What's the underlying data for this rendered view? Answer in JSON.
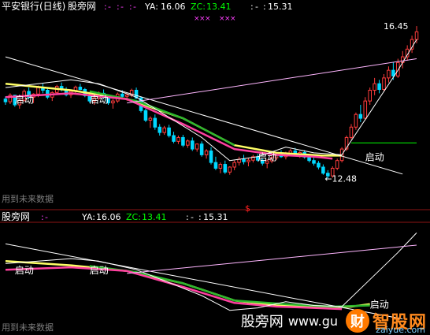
{
  "chart_data": [
    {
      "type": "candlestick",
      "panel": "main",
      "header": {
        "title": "平安银行(日线)",
        "indicator": "股旁网",
        "fields": [
          {
            "label": ":",
            "value": "-",
            "color": "#ff40ff"
          },
          {
            "label": ":",
            "value": "-",
            "color": "#ff40ff"
          },
          {
            "label": ":",
            "value": "-",
            "color": "#ff40ff"
          },
          {
            "label": "YA:",
            "value": "16.06",
            "color": "#ffffff"
          },
          {
            "label": "ZC:",
            "value": "13.41",
            "color": "#00ff00"
          },
          {
            "label": ":",
            "value": "-",
            "color": "#ffffff"
          },
          {
            "label": ":",
            "value": "15.31",
            "color": "#ffffff"
          }
        ]
      },
      "ohlc": [
        [
          14.55,
          14.62,
          14.4,
          14.48
        ],
        [
          14.48,
          14.7,
          14.42,
          14.65
        ],
        [
          14.65,
          14.66,
          14.35,
          14.4
        ],
        [
          14.4,
          14.55,
          14.3,
          14.52
        ],
        [
          14.52,
          14.8,
          14.48,
          14.75
        ],
        [
          14.75,
          14.85,
          14.55,
          14.6
        ],
        [
          14.6,
          14.7,
          14.45,
          14.68
        ],
        [
          14.68,
          14.9,
          14.6,
          14.85
        ],
        [
          14.85,
          14.95,
          14.7,
          14.78
        ],
        [
          14.78,
          14.82,
          14.55,
          14.6
        ],
        [
          14.6,
          14.75,
          14.5,
          14.72
        ],
        [
          14.72,
          14.92,
          14.66,
          14.88
        ],
        [
          14.88,
          14.98,
          14.75,
          14.8
        ],
        [
          14.8,
          14.86,
          14.62,
          14.66
        ],
        [
          14.66,
          14.8,
          14.58,
          14.75
        ],
        [
          14.75,
          14.9,
          14.7,
          14.86
        ],
        [
          14.86,
          14.95,
          14.78,
          14.8
        ],
        [
          14.8,
          14.84,
          14.6,
          14.64
        ],
        [
          14.64,
          14.7,
          14.45,
          14.5
        ],
        [
          14.5,
          14.62,
          14.4,
          14.58
        ],
        [
          14.58,
          14.75,
          14.52,
          14.7
        ],
        [
          14.7,
          14.8,
          14.55,
          14.6
        ],
        [
          14.6,
          14.66,
          14.4,
          14.45
        ],
        [
          14.45,
          14.55,
          14.3,
          14.5
        ],
        [
          14.5,
          14.72,
          14.45,
          14.68
        ],
        [
          14.68,
          14.78,
          14.58,
          14.62
        ],
        [
          14.62,
          14.7,
          14.5,
          14.66
        ],
        [
          14.66,
          14.82,
          14.6,
          14.78
        ],
        [
          14.78,
          14.85,
          14.55,
          14.58
        ],
        [
          14.58,
          14.62,
          14.2,
          14.25
        ],
        [
          14.25,
          14.3,
          13.95,
          14.0
        ],
        [
          14.0,
          14.1,
          13.8,
          14.05
        ],
        [
          14.05,
          14.15,
          13.75,
          13.82
        ],
        [
          13.82,
          13.9,
          13.6,
          13.68
        ],
        [
          13.68,
          13.85,
          13.62,
          13.8
        ],
        [
          13.8,
          13.88,
          13.55,
          13.6
        ],
        [
          13.6,
          13.7,
          13.4,
          13.45
        ],
        [
          13.45,
          13.6,
          13.38,
          13.55
        ],
        [
          13.55,
          13.62,
          13.3,
          13.35
        ],
        [
          13.35,
          13.5,
          13.28,
          13.46
        ],
        [
          13.46,
          13.55,
          13.2,
          13.25
        ],
        [
          13.25,
          13.4,
          13.18,
          13.38
        ],
        [
          13.38,
          13.45,
          13.05,
          13.1
        ],
        [
          13.1,
          13.25,
          13.0,
          13.2
        ],
        [
          13.2,
          13.3,
          12.85,
          12.9
        ],
        [
          12.9,
          13.05,
          12.7,
          12.75
        ],
        [
          12.75,
          12.9,
          12.62,
          12.85
        ],
        [
          12.85,
          12.95,
          12.6,
          12.65
        ],
        [
          12.65,
          12.8,
          12.58,
          12.78
        ],
        [
          12.78,
          12.95,
          12.7,
          12.9
        ],
        [
          12.9,
          13.05,
          12.82,
          12.98
        ],
        [
          12.98,
          13.1,
          12.85,
          12.92
        ],
        [
          12.92,
          13.02,
          12.8,
          12.96
        ],
        [
          12.96,
          13.1,
          12.9,
          13.05
        ],
        [
          13.05,
          13.12,
          12.92,
          12.96
        ],
        [
          12.96,
          13.0,
          12.82,
          12.88
        ],
        [
          12.88,
          12.98,
          12.75,
          12.94
        ],
        [
          12.94,
          13.08,
          12.88,
          13.02
        ],
        [
          13.02,
          13.15,
          12.96,
          13.1
        ],
        [
          13.1,
          13.22,
          13.02,
          13.05
        ],
        [
          13.05,
          13.18,
          12.98,
          13.14
        ],
        [
          13.14,
          13.25,
          13.08,
          13.2
        ],
        [
          13.2,
          13.28,
          13.08,
          13.12
        ],
        [
          13.12,
          13.2,
          13.02,
          13.16
        ],
        [
          13.16,
          13.22,
          13.0,
          13.04
        ],
        [
          13.04,
          13.1,
          12.9,
          12.95
        ],
        [
          12.95,
          13.02,
          12.82,
          12.88
        ],
        [
          12.88,
          12.94,
          12.72,
          12.78
        ],
        [
          12.78,
          12.85,
          12.58,
          12.62
        ],
        [
          12.62,
          12.7,
          12.48,
          12.55
        ],
        [
          12.55,
          12.8,
          12.5,
          12.75
        ],
        [
          12.75,
          13.0,
          12.7,
          12.95
        ],
        [
          12.95,
          13.3,
          12.9,
          13.25
        ],
        [
          13.25,
          13.6,
          13.2,
          13.55
        ],
        [
          13.55,
          13.9,
          13.5,
          13.82
        ],
        [
          13.82,
          14.2,
          13.75,
          14.15
        ],
        [
          14.15,
          14.4,
          13.95,
          14.05
        ],
        [
          14.05,
          14.6,
          14.0,
          14.5
        ],
        [
          14.5,
          14.85,
          14.4,
          14.78
        ],
        [
          14.78,
          15.1,
          14.65,
          14.95
        ],
        [
          14.95,
          15.05,
          14.7,
          14.8
        ],
        [
          14.8,
          15.2,
          14.75,
          15.1
        ],
        [
          15.1,
          15.4,
          14.98,
          15.3
        ],
        [
          15.3,
          15.5,
          15.05,
          15.15
        ],
        [
          15.15,
          15.6,
          15.1,
          15.5
        ],
        [
          15.5,
          15.8,
          15.35,
          15.65
        ],
        [
          15.65,
          15.95,
          15.55,
          15.85
        ],
        [
          15.85,
          16.2,
          15.75,
          16.1
        ],
        [
          16.1,
          16.45,
          16.0,
          16.3
        ]
      ],
      "lines": [
        {
          "color": "#ffff66",
          "width": 2.5,
          "points": [
            [
              0,
              14.95
            ],
            [
              14,
              14.78
            ],
            [
              26,
              14.55
            ],
            [
              38,
              14.05
            ],
            [
              49,
              13.35
            ],
            [
              58,
              13.15
            ],
            [
              68,
              13.08
            ],
            [
              72,
              13.08
            ]
          ]
        },
        {
          "color": "#2db82d",
          "width": 2.5,
          "points": [
            [
              18,
              14.75
            ],
            [
              28,
              14.5
            ],
            [
              38,
              14.05
            ],
            [
              49,
              13.35
            ]
          ]
        },
        {
          "color": "#ff40a0",
          "width": 2.5,
          "points": [
            [
              0,
              14.6
            ],
            [
              14,
              14.7
            ],
            [
              26,
              14.55
            ],
            [
              38,
              13.9
            ],
            [
              49,
              13.25
            ],
            [
              58,
              13.1
            ],
            [
              66,
              13.05
            ],
            [
              70,
              13.0
            ]
          ]
        },
        {
          "color": "#ffffff",
          "width": 1,
          "points": [
            [
              0,
              14.85
            ],
            [
              14,
              15.05
            ],
            [
              20,
              14.95
            ],
            [
              28,
              14.6
            ],
            [
              34,
              14.15
            ],
            [
              42,
              13.55
            ],
            [
              48,
              12.95
            ],
            [
              54,
              13.05
            ],
            [
              60,
              13.3
            ],
            [
              66,
              13.15
            ],
            [
              72,
              13.1
            ],
            [
              78,
              14.2
            ],
            [
              84,
              15.3
            ],
            [
              88,
              16.1
            ]
          ]
        },
        {
          "color": "#ffffff",
          "width": 1,
          "points": [
            [
              0,
              15.65
            ],
            [
              85,
              12.6
            ]
          ]
        },
        {
          "color": "#ffb6ff",
          "width": 1,
          "points": [
            [
              26,
              14.45
            ],
            [
              88,
              15.6
            ]
          ]
        },
        {
          "color": "#00ff00",
          "width": 1,
          "points": [
            [
              74,
              13.41
            ],
            [
              88,
              13.41
            ]
          ]
        }
      ],
      "y_range": [
        12.0,
        16.8
      ],
      "markers": [
        {
          "text": "启动",
          "x": 2,
          "y": 14.45,
          "color": "#ffffff"
        },
        {
          "text": "启动",
          "x": 18,
          "y": 14.45,
          "color": "#ffffff"
        },
        {
          "text": "启动",
          "x": 54,
          "y": 12.95,
          "color": "#ffffff"
        },
        {
          "text": "启动",
          "x": 77,
          "y": 12.95,
          "color": "#ffffff"
        }
      ],
      "annotations": [
        {
          "text": "16.45",
          "x": 88,
          "y": 16.45,
          "color": "#ffffff"
        },
        {
          "text": "←12.48",
          "x": 69,
          "y": 12.48,
          "color": "#ffffff"
        }
      ],
      "bottom_text": "用到未来数据",
      "signal": "$"
    },
    {
      "type": "line",
      "panel": "sub",
      "header": {
        "indicator": "股旁网",
        "fields": [
          {
            "label": ":",
            "value": "-",
            "color": "#ff40ff"
          },
          {
            "label": "YA:",
            "value": "16.06",
            "color": "#ffffff"
          },
          {
            "label": "ZC:",
            "value": "13.41",
            "color": "#00ff00"
          },
          {
            "label": ":",
            "value": "-",
            "color": "#ffffff"
          },
          {
            "label": ":",
            "value": "15.31",
            "color": "#ffffff"
          }
        ]
      },
      "lines": [
        {
          "color": "#ffff66",
          "width": 2.5,
          "points": [
            [
              0,
              14.95
            ],
            [
              14,
              14.78
            ],
            [
              26,
              14.55
            ],
            [
              38,
              14.05
            ],
            [
              49,
              13.35
            ],
            [
              58,
              13.15
            ],
            [
              68,
              13.08
            ],
            [
              74,
              13.1
            ],
            [
              78,
              13.2
            ]
          ]
        },
        {
          "color": "#2db82d",
          "width": 2.5,
          "points": [
            [
              18,
              14.75
            ],
            [
              28,
              14.5
            ],
            [
              38,
              14.05
            ],
            [
              49,
              13.35
            ],
            [
              60,
              13.2
            ],
            [
              70,
              13.1
            ],
            [
              78,
              13.15
            ]
          ]
        },
        {
          "color": "#ff40a0",
          "width": 2.5,
          "points": [
            [
              0,
              14.6
            ],
            [
              14,
              14.7
            ],
            [
              26,
              14.55
            ],
            [
              38,
              13.9
            ],
            [
              49,
              13.25
            ],
            [
              58,
              13.1
            ],
            [
              66,
              13.05
            ],
            [
              72,
              13.0
            ]
          ]
        },
        {
          "color": "#ffffff",
          "width": 1,
          "points": [
            [
              0,
              14.85
            ],
            [
              14,
              15.05
            ],
            [
              20,
              14.95
            ],
            [
              28,
              14.6
            ],
            [
              34,
              14.15
            ],
            [
              42,
              13.55
            ],
            [
              48,
              12.95
            ],
            [
              54,
              13.05
            ],
            [
              60,
              13.3
            ],
            [
              66,
              13.15
            ],
            [
              72,
              13.1
            ],
            [
              78,
              14.2
            ],
            [
              84,
              15.3
            ],
            [
              88,
              16.1
            ]
          ]
        },
        {
          "color": "#ffffff",
          "width": 1,
          "points": [
            [
              0,
              15.65
            ],
            [
              85,
              12.6
            ]
          ]
        },
        {
          "color": "#ffb6ff",
          "width": 1,
          "points": [
            [
              26,
              14.45
            ],
            [
              88,
              15.6
            ]
          ]
        }
      ],
      "y_range": [
        12.3,
        16.4
      ],
      "markers": [
        {
          "text": "启动",
          "x": 2,
          "y": 14.45,
          "color": "#ffffff"
        },
        {
          "text": "启动",
          "x": 18,
          "y": 14.45,
          "color": "#ffffff"
        },
        {
          "text": "启动",
          "x": 78,
          "y": 13.05,
          "color": "#ffffff"
        }
      ],
      "bottom_text": "用到未来数据"
    }
  ],
  "watermark": {
    "site": "股旁网",
    "url": "www.gu",
    "brand": "智股网",
    "brand_url": "zaiyue.com",
    "badge": "财"
  }
}
